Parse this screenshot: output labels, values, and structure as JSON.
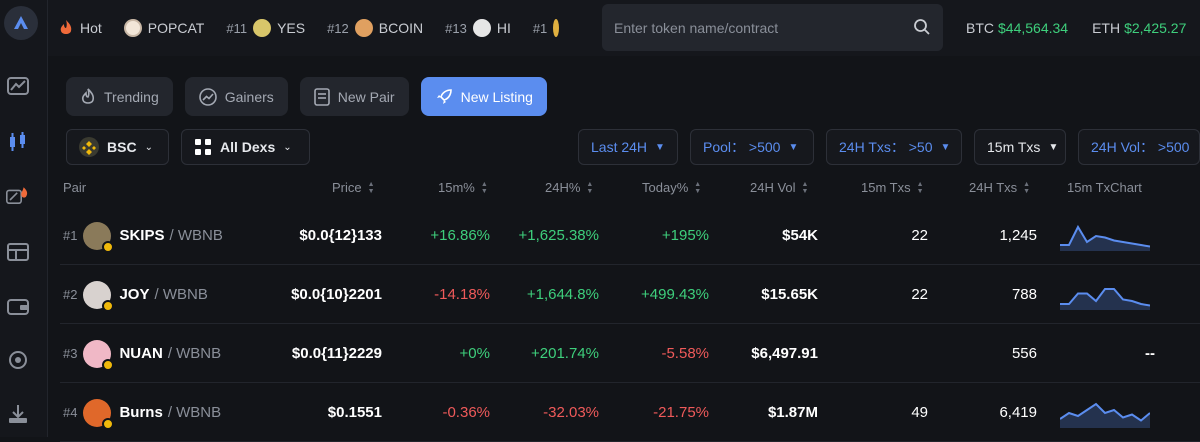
{
  "colors": {
    "accent": "#5b8def",
    "up": "#3ecf7c",
    "down": "#ef5a5a",
    "bnb": "#f0b90b"
  },
  "ticker": [
    {
      "rank": "",
      "name": "Hot",
      "icon": "fire-icon"
    },
    {
      "rank": "",
      "name": "POPCAT",
      "icon": "popcat-logo-icon"
    },
    {
      "rank": "#11",
      "name": "YES",
      "icon": "yes-logo-icon"
    },
    {
      "rank": "#12",
      "name": "BCOIN",
      "icon": "bcoin-logo-icon"
    },
    {
      "rank": "#13",
      "name": "HI",
      "icon": "hi-logo-icon"
    },
    {
      "rank": "#1",
      "name": "",
      "icon": "token-logo-icon"
    }
  ],
  "search": {
    "placeholder": "Enter token name/contract"
  },
  "prices": [
    {
      "label": "BTC",
      "value": "$44,564.34"
    },
    {
      "label": "ETH",
      "value": "$2,425.27"
    }
  ],
  "tabs": [
    {
      "label": "Trending",
      "icon": "flame-icon",
      "active": false
    },
    {
      "label": "Gainers",
      "icon": "trend-up-icon",
      "active": false
    },
    {
      "label": "New Pair",
      "icon": "new-pair-icon",
      "active": false
    },
    {
      "label": "New Listing",
      "icon": "rocket-icon",
      "active": true
    }
  ],
  "filters": {
    "chain": "BSC",
    "dex": "All Dexs",
    "period": "Last 24H",
    "pool": "Pool： >500",
    "txs24": "24H Txs： >50",
    "txs15": "15m Txs",
    "vol24": "24H Vol： >500"
  },
  "columns": {
    "pair": "Pair",
    "price": "Price",
    "m15": "15m%",
    "h24": "24H%",
    "today": "Today%",
    "vol": "24H Vol",
    "txs15": "15m Txs",
    "txs24": "24H Txs",
    "chart": "15m TxChart"
  },
  "rows": [
    {
      "rank": "#1",
      "symbol": "SKIPS",
      "quote": "/ WBNB",
      "price": "$0.0{12}133",
      "m15": "+16.86%",
      "h24": "+1,625.38%",
      "today": "+195%",
      "vol": "$54K",
      "txs15": "22",
      "txs24": "1,245",
      "chart": [
        0.2,
        0.2,
        0.8,
        0.3,
        0.5,
        0.45,
        0.35,
        0.3,
        0.25,
        0.2,
        0.15
      ],
      "avatar": "#8a7a5a"
    },
    {
      "rank": "#2",
      "symbol": "JOY",
      "quote": "/ WBNB",
      "price": "$0.0{10}2201",
      "m15": "-14.18%",
      "h24": "+1,644.8%",
      "today": "+499.43%",
      "vol": "$15.65K",
      "txs15": "22",
      "txs24": "788",
      "chart": [
        0.2,
        0.2,
        0.55,
        0.55,
        0.3,
        0.7,
        0.7,
        0.35,
        0.3,
        0.2,
        0.15
      ],
      "avatar": "#d8d2cf"
    },
    {
      "rank": "#3",
      "symbol": "NUAN",
      "quote": "/ WBNB",
      "price": "$0.0{11}2229",
      "m15": "+0%",
      "h24": "+201.74%",
      "today": "-5.58%",
      "vol": "$6,497.91",
      "txs15": "",
      "txs24": "556",
      "chart": [],
      "chartEmpty": "--",
      "avatar": "#f0b8c6"
    },
    {
      "rank": "#4",
      "symbol": "Burns",
      "quote": "/ WBNB",
      "price": "$0.1551",
      "m15": "-0.36%",
      "h24": "-32.03%",
      "today": "-21.75%",
      "vol": "$1.87M",
      "txs15": "49",
      "txs24": "6,419",
      "chart": [
        0.3,
        0.5,
        0.4,
        0.6,
        0.8,
        0.5,
        0.6,
        0.35,
        0.45,
        0.25,
        0.5
      ],
      "avatar": "#e0682a"
    }
  ]
}
